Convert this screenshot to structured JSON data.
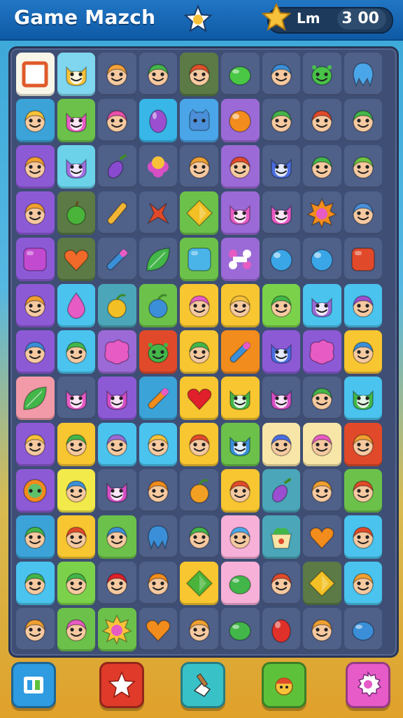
{
  "header": {
    "title": "Game Mazch",
    "score_label": "Lm",
    "score_value": "3 00"
  },
  "board": {
    "rows": [
      [
        [
          "#f8f6e8",
          "square",
          "#e05a2a"
        ],
        [
          "#7fd6ee",
          "cat",
          "#f7c23a"
        ],
        [
          "#4f6089",
          "face",
          "#f4a23a"
        ],
        [
          "#4f6089",
          "face",
          "#43b649"
        ],
        [
          "#5b7a45",
          "face",
          "#e0502a"
        ],
        [
          "#4f6089",
          "blob",
          "#49c745"
        ],
        [
          "#4f6089",
          "face",
          "#3b8fd8"
        ],
        [
          "#4f6089",
          "alien",
          "#48c248"
        ],
        [
          "#4f6089",
          "squid",
          "#4aa6e8"
        ]
      ],
      [
        [
          "#3ca3d8",
          "face",
          "#f7c23a"
        ],
        [
          "#6cc14a",
          "cat",
          "#e75bc4"
        ],
        [
          "#4f6089",
          "face",
          "#e74fa9"
        ],
        [
          "#38b6e8",
          "oval",
          "#9b4fd0"
        ],
        [
          "#4aa6e8",
          "box",
          "#4a8fd8"
        ],
        [
          "#9b6ad6",
          "orb",
          "#f28c1c"
        ],
        [
          "#4f6089",
          "face",
          "#43b649"
        ],
        [
          "#4f6089",
          "face",
          "#e04a2a"
        ],
        [
          "#4f6089",
          "face",
          "#43b649"
        ]
      ],
      [
        [
          "#8d5ad6",
          "face",
          "#f0a030"
        ],
        [
          "#6bd2ea",
          "cat",
          "#a26ee0"
        ],
        [
          "#4f6089",
          "eggplant",
          "#8a4ad0"
        ],
        [
          "#4f6089",
          "flower",
          "#d64fc4"
        ],
        [
          "#4f6089",
          "face",
          "#f0a030"
        ],
        [
          "#9b6ad6",
          "face",
          "#e04a2a"
        ],
        [
          "#4f6089",
          "cat",
          "#4a6ee0"
        ],
        [
          "#4f6089",
          "face",
          "#43b649"
        ],
        [
          "#4f6089",
          "face",
          "#6cc440"
        ]
      ],
      [
        [
          "#8d5ad6",
          "face",
          "#f0a030"
        ],
        [
          "#5b7a45",
          "apple",
          "#4ab43a"
        ],
        [
          "#4f6089",
          "bar",
          "#f2b534"
        ],
        [
          "#4f6089",
          "cross",
          "#e04a2a"
        ],
        [
          "#6cc14a",
          "gem",
          "#f2c024"
        ],
        [
          "#9b6ad6",
          "cat",
          "#e75bc4"
        ],
        [
          "#4f6089",
          "cat",
          "#e75bc4"
        ],
        [
          "#4f6089",
          "sun",
          "#f28c1c"
        ],
        [
          "#4f6089",
          "face",
          "#4a8fd8"
        ]
      ],
      [
        [
          "#8d5ad6",
          "block",
          "#c24ad0"
        ],
        [
          "#5b7a45",
          "heart",
          "#f26a2a"
        ],
        [
          "#4f6089",
          "tube",
          "#3b8fd8"
        ],
        [
          "#4f6089",
          "leaf",
          "#43b649"
        ],
        [
          "#6cc14a",
          "block",
          "#4ab4e8"
        ],
        [
          "#9b6ad6",
          "bone",
          "#e75bc4"
        ],
        [
          "#4f6089",
          "orb",
          "#3aa6e8"
        ],
        [
          "#4f6089",
          "orb",
          "#3aa6e8"
        ],
        [
          "#4f6089",
          "block",
          "#e04a2a"
        ]
      ],
      [
        [
          "#8d5ad6",
          "face",
          "#f0a030"
        ],
        [
          "#4ac3ee",
          "drop",
          "#e75bc4"
        ],
        [
          "#4aa6b8",
          "fruit",
          "#f2c024"
        ],
        [
          "#6cc14a",
          "fruit",
          "#3b8fd8"
        ],
        [
          "#f7c630",
          "face",
          "#e75bc4"
        ],
        [
          "#f7c630",
          "face",
          "#f7c23a"
        ],
        [
          "#7bd24a",
          "face",
          "#43b649"
        ],
        [
          "#4ac3ee",
          "cat",
          "#9b6ad6"
        ],
        [
          "#4ac3ee",
          "face",
          "#9b4fd0"
        ]
      ],
      [
        [
          "#8d5ad6",
          "face",
          "#3b8fd8"
        ],
        [
          "#4ac3ee",
          "face",
          "#43b649"
        ],
        [
          "#9b6ad6",
          "splat",
          "#e75bc4"
        ],
        [
          "#e04a2a",
          "alien",
          "#43b649"
        ],
        [
          "#f7c630",
          "face",
          "#43b649"
        ],
        [
          "#f28c1c",
          "tube",
          "#3b8fd8"
        ],
        [
          "#8d5ad6",
          "cat",
          "#4a6ee0"
        ],
        [
          "#8d5ad6",
          "splat",
          "#e75bc4"
        ],
        [
          "#f7c630",
          "face",
          "#3b8fd8"
        ]
      ],
      [
        [
          "#f29aa8",
          "leaf",
          "#43b649"
        ],
        [
          "#4f6089",
          "cat",
          "#e75bc4"
        ],
        [
          "#8d5ad6",
          "cat",
          "#d64fc4"
        ],
        [
          "#3ca3d8",
          "tube",
          "#f28c1c"
        ],
        [
          "#f7c630",
          "heart",
          "#e0202a"
        ],
        [
          "#f7c630",
          "cat",
          "#43b649"
        ],
        [
          "#4f6089",
          "cat",
          "#d64fc4"
        ],
        [
          "#4f6089",
          "face",
          "#43b649"
        ],
        [
          "#4ac3ee",
          "cat",
          "#43b649"
        ]
      ],
      [
        [
          "#8d5ad6",
          "face",
          "#f7c23a"
        ],
        [
          "#f7c630",
          "face",
          "#43b649"
        ],
        [
          "#4ac3ee",
          "face",
          "#9b6ad6"
        ],
        [
          "#4ac3ee",
          "face",
          "#f7c23a"
        ],
        [
          "#f7c630",
          "face",
          "#e04a2a"
        ],
        [
          "#6cc14a",
          "cat",
          "#3b8fd8"
        ],
        [
          "#f7e6a8",
          "face",
          "#4a6ee0"
        ],
        [
          "#f7e6a8",
          "face",
          "#e75bc4"
        ],
        [
          "#e04a2a",
          "face",
          "#f0a030"
        ]
      ],
      [
        [
          "#8d5ad6",
          "ring",
          "#f28c1c"
        ],
        [
          "#f2e94a",
          "face",
          "#3b8fd8"
        ],
        [
          "#4f6089",
          "cat",
          "#d64fc4"
        ],
        [
          "#4f6089",
          "face",
          "#f28c1c"
        ],
        [
          "#4f6089",
          "fruit",
          "#f2a024"
        ],
        [
          "#f7c630",
          "face",
          "#e04a2a"
        ],
        [
          "#4aa6b8",
          "eggplant",
          "#9b4fd0"
        ],
        [
          "#4f6089",
          "face",
          "#f0a030"
        ],
        [
          "#6cc14a",
          "face",
          "#e04a2a"
        ]
      ],
      [
        [
          "#3ca3d8",
          "face",
          "#43b649"
        ],
        [
          "#f7c630",
          "face",
          "#e04a2a"
        ],
        [
          "#6cc14a",
          "face",
          "#3b8fd8"
        ],
        [
          "#4f6089",
          "squid",
          "#3b8fd8"
        ],
        [
          "#4f6089",
          "face",
          "#43b649"
        ],
        [
          "#f7b0d8",
          "face",
          "#4aa6e8"
        ],
        [
          "#4aa6b8",
          "pot",
          "#43b649"
        ],
        [
          "#4f6089",
          "heart",
          "#f28c1c"
        ],
        [
          "#4ac3ee",
          "face",
          "#e04a2a"
        ]
      ],
      [
        [
          "#4ac3ee",
          "face",
          "#43b649"
        ],
        [
          "#7bd24a",
          "face",
          "#43b649"
        ],
        [
          "#4f6089",
          "face",
          "#e0202a"
        ],
        [
          "#4f6089",
          "face",
          "#f28c1c"
        ],
        [
          "#f7c630",
          "gem",
          "#4ab43a"
        ],
        [
          "#f7b0d8",
          "blob",
          "#43b649"
        ],
        [
          "#4f6089",
          "face",
          "#e04a2a"
        ],
        [
          "#5b7a45",
          "gem",
          "#f2c024"
        ],
        [
          "#4ac3ee",
          "face",
          "#f0a030"
        ]
      ],
      [
        [
          "#4f6089",
          "face",
          "#f0a030"
        ],
        [
          "#6cc14a",
          "face",
          "#e75bc4"
        ],
        [
          "#6cc14a",
          "sun",
          "#f7c23a"
        ],
        [
          "#4f6089",
          "heart",
          "#f28c1c"
        ],
        [
          "#4f6089",
          "face",
          "#f0a030"
        ],
        [
          "#4f6089",
          "blob",
          "#43b649"
        ],
        [
          "#4f6089",
          "egg",
          "#e0302a"
        ],
        [
          "#4f6089",
          "face",
          "#f0a030"
        ],
        [
          "#4f6089",
          "blob",
          "#3b8fd8"
        ]
      ]
    ]
  },
  "toolbar": {
    "buttons": [
      {
        "name": "stats-button",
        "icon": "bars-icon",
        "color": "#2f9be0"
      },
      {
        "name": "star-button",
        "icon": "star-icon",
        "color": "#e03b2a"
      },
      {
        "name": "hammer-button",
        "icon": "hammer-icon",
        "color": "#39c1c8"
      },
      {
        "name": "character-button",
        "icon": "character-icon",
        "color": "#5dc23a"
      },
      {
        "name": "settings-button",
        "icon": "gear-icon",
        "color": "#e65bc8"
      }
    ]
  },
  "colors": {
    "header": "#1366b6",
    "board_bg": "#3e4e74",
    "star": "#f7c23a"
  }
}
